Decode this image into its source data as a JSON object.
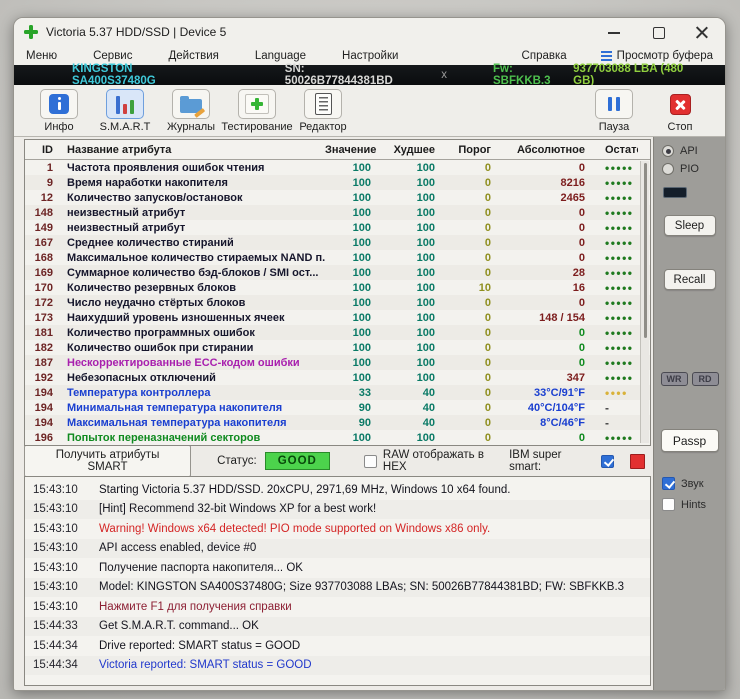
{
  "window": {
    "title": "Victoria 5.37 HDD/SSD | Device 5"
  },
  "menu": {
    "items": [
      "Меню",
      "Сервис",
      "Действия",
      "Language",
      "Настройки"
    ],
    "help": "Справка",
    "buffer_view": "Просмотр буфера"
  },
  "drive_bar": {
    "model": "KINGSTON SA400S37480G",
    "serial": "SN: 50026B77844381BD",
    "separator": "x",
    "firmware": "Fw: SBFKKB.3",
    "capacity": "937703088 LBA (480 GB)"
  },
  "toolbar": {
    "info": "Инфо",
    "smart": "S.M.A.R.T",
    "journals": "Журналы",
    "testing": "Тестирование",
    "editor": "Редактор",
    "pause": "Пауза",
    "stop": "Стоп"
  },
  "smart_table": {
    "columns": [
      "ID",
      "Название атрибута",
      "Значение",
      "Худшее",
      "Порог",
      "Абсолютное",
      "Остаток"
    ],
    "rows": [
      {
        "id": "1",
        "name": "Частота проявления ошибок чтения",
        "name_color": "dark",
        "value": "100",
        "worst": "100",
        "threshold": "0",
        "raw": "0",
        "raw_color": "maroon",
        "dots": 5,
        "dots_color": "green",
        "dots_text": ""
      },
      {
        "id": "9",
        "name": "Время наработки накопителя",
        "name_color": "dark",
        "value": "100",
        "worst": "100",
        "threshold": "0",
        "raw": "8216",
        "raw_color": "maroon",
        "dots": 5,
        "dots_color": "green",
        "dots_text": ""
      },
      {
        "id": "12",
        "name": "Количество запусков/остановок",
        "name_color": "dark",
        "value": "100",
        "worst": "100",
        "threshold": "0",
        "raw": "2465",
        "raw_color": "maroon",
        "dots": 5,
        "dots_color": "green",
        "dots_text": ""
      },
      {
        "id": "148",
        "name": "неизвестный атрибут",
        "name_color": "dark",
        "value": "100",
        "worst": "100",
        "threshold": "0",
        "raw": "0",
        "raw_color": "maroon",
        "dots": 5,
        "dots_color": "green",
        "dots_text": ""
      },
      {
        "id": "149",
        "name": "неизвестный атрибут",
        "name_color": "dark",
        "value": "100",
        "worst": "100",
        "threshold": "0",
        "raw": "0",
        "raw_color": "maroon",
        "dots": 5,
        "dots_color": "green",
        "dots_text": ""
      },
      {
        "id": "167",
        "name": "Среднее количество стираний",
        "name_color": "dark",
        "value": "100",
        "worst": "100",
        "threshold": "0",
        "raw": "0",
        "raw_color": "maroon",
        "dots": 5,
        "dots_color": "green",
        "dots_text": ""
      },
      {
        "id": "168",
        "name": "Максимальное количество стираемых NAND п...",
        "name_color": "dark",
        "value": "100",
        "worst": "100",
        "threshold": "0",
        "raw": "0",
        "raw_color": "maroon",
        "dots": 5,
        "dots_color": "green",
        "dots_text": ""
      },
      {
        "id": "169",
        "name": "Суммарное количество бэд-блоков / SMI ост...",
        "name_color": "dark",
        "value": "100",
        "worst": "100",
        "threshold": "0",
        "raw": "28",
        "raw_color": "maroon",
        "dots": 5,
        "dots_color": "green",
        "dots_text": ""
      },
      {
        "id": "170",
        "name": "Количество резервных блоков",
        "name_color": "dark",
        "value": "100",
        "worst": "100",
        "threshold": "10",
        "raw": "16",
        "raw_color": "maroon",
        "dots": 5,
        "dots_color": "green",
        "dots_text": ""
      },
      {
        "id": "172",
        "name": "Число неудачно стёртых блоков",
        "name_color": "dark",
        "value": "100",
        "worst": "100",
        "threshold": "0",
        "raw": "0",
        "raw_color": "maroon",
        "dots": 5,
        "dots_color": "green",
        "dots_text": ""
      },
      {
        "id": "173",
        "name": "Наихудший уровень изношенных ячеек",
        "name_color": "dark",
        "value": "100",
        "worst": "100",
        "threshold": "0",
        "raw": "148 / 154",
        "raw_color": "maroon",
        "dots": 5,
        "dots_color": "green",
        "dots_text": ""
      },
      {
        "id": "181",
        "name": "Количество программных ошибок",
        "name_color": "dark",
        "value": "100",
        "worst": "100",
        "threshold": "0",
        "raw": "0",
        "raw_color": "green",
        "dots": 5,
        "dots_color": "green",
        "dots_text": ""
      },
      {
        "id": "182",
        "name": "Количество ошибок при стирании",
        "name_color": "dark",
        "value": "100",
        "worst": "100",
        "threshold": "0",
        "raw": "0",
        "raw_color": "green",
        "dots": 5,
        "dots_color": "green",
        "dots_text": ""
      },
      {
        "id": "187",
        "name": "Нескорректированные ECC-кодом ошибки",
        "name_color": "magenta",
        "value": "100",
        "worst": "100",
        "threshold": "0",
        "raw": "0",
        "raw_color": "green",
        "dots": 5,
        "dots_color": "green",
        "dots_text": ""
      },
      {
        "id": "192",
        "name": "Небезопасных отключений",
        "name_color": "dark",
        "value": "100",
        "worst": "100",
        "threshold": "0",
        "raw": "347",
        "raw_color": "maroon",
        "dots": 5,
        "dots_color": "green",
        "dots_text": ""
      },
      {
        "id": "194",
        "name": "Температура контроллера",
        "name_color": "blue",
        "value": "33",
        "worst": "40",
        "threshold": "0",
        "raw": "33°C/91°F",
        "raw_color": "blue",
        "dots": 4,
        "dots_color": "yellow",
        "dots_text": ""
      },
      {
        "id": "194",
        "name": "Минимальная температура накопителя",
        "name_color": "blue",
        "value": "90",
        "worst": "40",
        "threshold": "0",
        "raw": "40°C/104°F",
        "raw_color": "blue",
        "dots": 0,
        "dots_color": "",
        "dots_text": "-"
      },
      {
        "id": "194",
        "name": "Максимальная температура накопителя",
        "name_color": "blue",
        "value": "90",
        "worst": "40",
        "threshold": "0",
        "raw": "8°C/46°F",
        "raw_color": "blue",
        "dots": 0,
        "dots_color": "",
        "dots_text": "-"
      },
      {
        "id": "196",
        "name": "Попыток переназначений секторов",
        "name_color": "green",
        "value": "100",
        "worst": "100",
        "threshold": "0",
        "raw": "0",
        "raw_color": "green",
        "dots": 5,
        "dots_color": "green",
        "dots_text": ""
      }
    ]
  },
  "status_bar": {
    "get_smart_button": "Получить атрибуты SMART",
    "status_label": "Статус:",
    "status_value": "GOOD",
    "raw_hex_label": "RAW отображать в HEX",
    "raw_hex_checked": false,
    "ibm_label": "IBM super smart:",
    "ibm_checked": true
  },
  "sidebar": {
    "api_label": "API",
    "api_selected": true,
    "pio_label": "PIO",
    "pio_selected": false,
    "sleep": "Sleep",
    "recall": "Recall",
    "wr": "WR",
    "rd": "RD",
    "passp": "Passp",
    "sound_label": "Звук",
    "sound_checked": true,
    "hints_label": "Hints",
    "hints_checked": false
  },
  "log": {
    "lines": [
      {
        "time": "15:43:10",
        "text": "Starting Victoria 5.37 HDD/SSD. 20xCPU, 2971,69 MHz, Windows 10 x64 found.",
        "color": "dark"
      },
      {
        "time": "15:43:10",
        "text": "[Hint] Recommend 32-bit Windows XP for a best work!",
        "color": "dark"
      },
      {
        "time": "15:43:10",
        "text": "Warning! Windows x64 detected! PIO mode supported on Windows x86 only.",
        "color": "red"
      },
      {
        "time": "15:43:10",
        "text": "API access enabled, device #0",
        "color": "dark"
      },
      {
        "time": "15:43:10",
        "text": "Получение паспорта накопителя... OK",
        "color": "dark"
      },
      {
        "time": "15:43:10",
        "text": "Model: KINGSTON SA400S37480G; Size 937703088 LBAs; SN: 50026B77844381BD; FW: SBFKKB.3",
        "color": "dark"
      },
      {
        "time": "15:43:10",
        "text": "Нажмите F1 для получения справки",
        "color": "darkred"
      },
      {
        "time": "15:44:33",
        "text": "Get S.M.A.R.T. command... OK",
        "color": "dark"
      },
      {
        "time": "15:44:34",
        "text": "Drive reported: SMART status = GOOD",
        "color": "dark"
      },
      {
        "time": "15:44:34",
        "text": "Victoria reported: SMART status = GOOD",
        "color": "blue"
      }
    ]
  },
  "colors": {
    "good_badge_bg": "#4cd34c",
    "model_cyan": "#3fc9d9",
    "firmware_green": "#4ec04e",
    "capacity_green": "#90cf3f",
    "dots_green": "#1f7a1f",
    "dots_yellow": "#d9b23a",
    "value_teal": "#0a7a66",
    "threshold_olive": "#8f8f1e",
    "raw_maroon": "#7c1d1d",
    "temp_blue": "#1a3fd0",
    "warning_red": "#d42525",
    "accent_blue": "#2f6fd6"
  }
}
